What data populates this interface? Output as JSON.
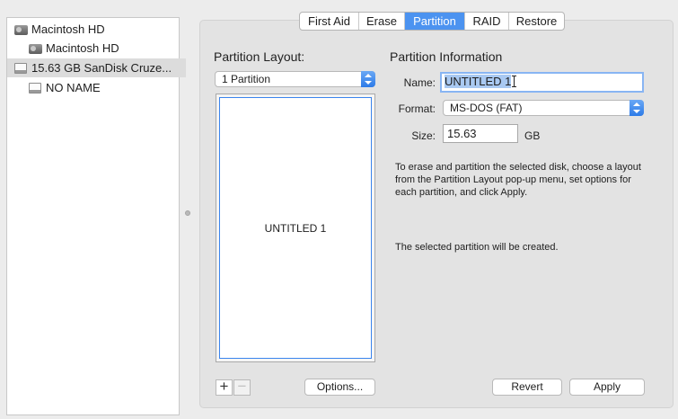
{
  "sidebar": {
    "items": [
      {
        "label": "Macintosh HD",
        "icon": "hard-disk-icon"
      },
      {
        "label": "Macintosh HD",
        "icon": "hard-disk-icon"
      },
      {
        "label": "15.63 GB SanDisk Cruze...",
        "icon": "usb-drive-icon"
      },
      {
        "label": "NO NAME",
        "icon": "usb-drive-icon"
      }
    ]
  },
  "tabs": [
    {
      "label": "First Aid"
    },
    {
      "label": "Erase"
    },
    {
      "label": "Partition"
    },
    {
      "label": "RAID"
    },
    {
      "label": "Restore"
    }
  ],
  "partition_layout": {
    "title": "Partition Layout:",
    "selected": "1 Partition",
    "partition_label": "UNTITLED 1",
    "add_symbol": "+",
    "remove_symbol": "−",
    "options_label": "Options..."
  },
  "partition_info": {
    "title": "Partition Information",
    "name_label": "Name:",
    "name_value": "UNTITLED 1",
    "format_label": "Format:",
    "format_value": "MS-DOS (FAT)",
    "size_label": "Size:",
    "size_value": "15.63",
    "size_unit": "GB",
    "instructions": "To erase and partition the selected disk, choose a layout from the Partition Layout pop-up menu, set options for each partition, and click Apply.",
    "status": "The selected partition will be created.",
    "revert_label": "Revert",
    "apply_label": "Apply"
  },
  "colors": {
    "accent": "#4c93f0",
    "selection": "#a9c9f2"
  }
}
